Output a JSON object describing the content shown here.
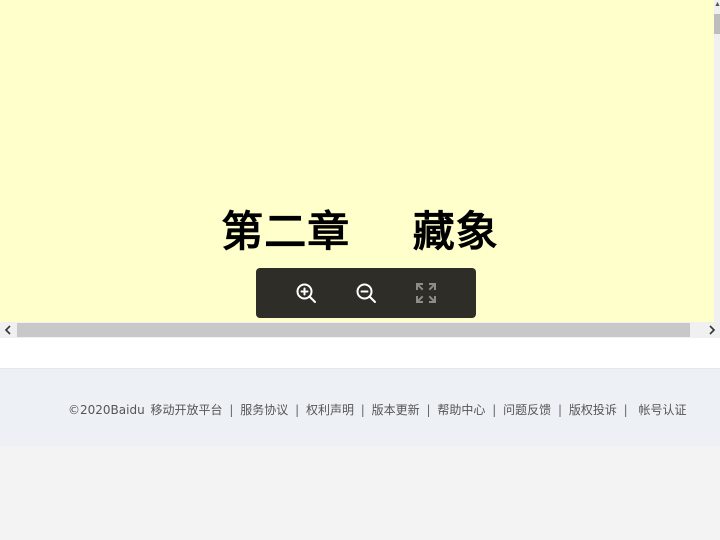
{
  "document": {
    "chapter_title": "第二章    藏象",
    "page_color": "#ffffcc"
  },
  "toolbar": {
    "background": "#2e2d27",
    "buttons": [
      {
        "icon": "zoom-in-icon",
        "enabled": true
      },
      {
        "icon": "zoom-out-icon",
        "enabled": true
      },
      {
        "icon": "fullscreen-icon",
        "enabled": false
      }
    ]
  },
  "scrollbars": {
    "left_arrow": "‹",
    "right_arrow": "›",
    "up_arrow": "▲"
  },
  "footer": {
    "copyright": "©2020Baidu",
    "links": [
      "移动开放平台",
      "服务协议",
      "权利声明",
      "版本更新",
      "帮助中心",
      "问题反馈",
      "版权投诉"
    ],
    "last_link": "帐号认证",
    "separator": "|"
  }
}
